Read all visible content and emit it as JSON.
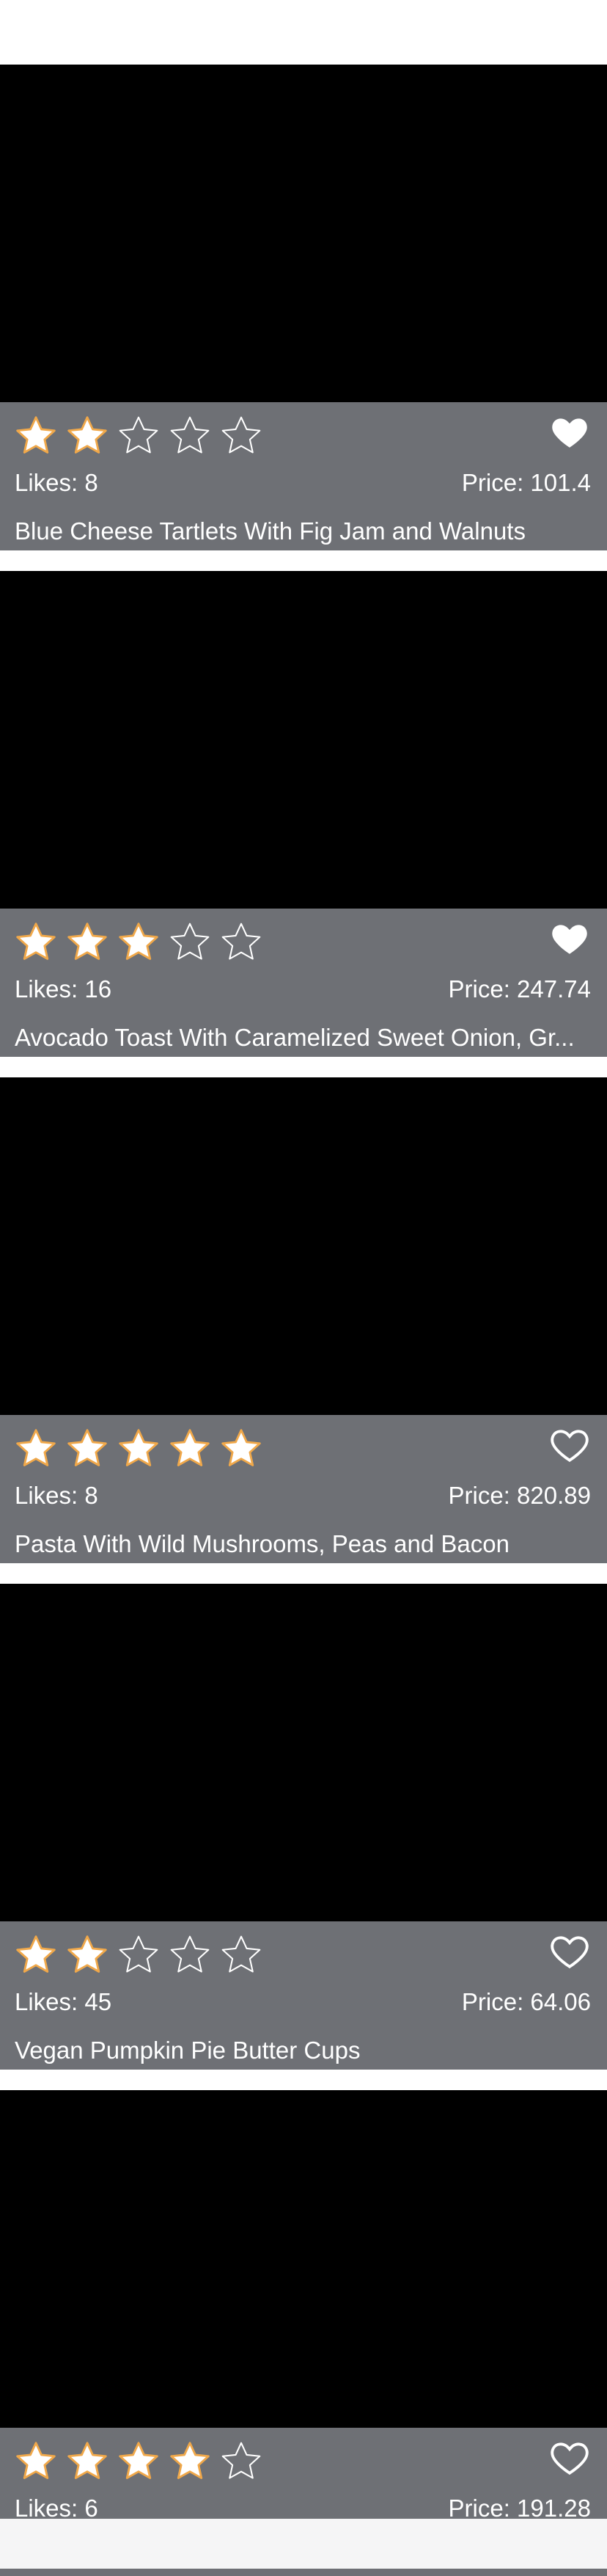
{
  "colors": {
    "card_info_background": "#6e7075",
    "image_placeholder": "#000000",
    "star_filled": "#ffffff",
    "star_outline_glow": "#f0a84a",
    "star_empty_stroke": "#ffffff"
  },
  "icons": {
    "star_filled": "star-filled-icon",
    "star_empty": "star-empty-icon",
    "heart_filled": "heart-filled-icon",
    "heart_outline": "heart-outline-icon"
  },
  "rating_max": 5,
  "recipes": [
    {
      "rating": 2,
      "favorite": true,
      "likes": "Likes: 8",
      "price": "Price: 101.4",
      "title": "Blue Cheese Tartlets With Fig Jam and Walnuts"
    },
    {
      "rating": 3,
      "favorite": true,
      "likes": "Likes: 16",
      "price": "Price: 247.74",
      "title": "Avocado Toast With Caramelized Sweet Onion, Gr..."
    },
    {
      "rating": 5,
      "favorite": false,
      "likes": "Likes: 8",
      "price": "Price: 820.89",
      "title": "Pasta With Wild Mushrooms, Peas and Bacon"
    },
    {
      "rating": 2,
      "favorite": false,
      "likes": "Likes: 45",
      "price": "Price: 64.06",
      "title": "Vegan Pumpkin Pie Butter Cups"
    },
    {
      "rating": 4,
      "favorite": false,
      "likes": "Likes: 6",
      "price": "Price: 191.28",
      "title": ""
    }
  ]
}
